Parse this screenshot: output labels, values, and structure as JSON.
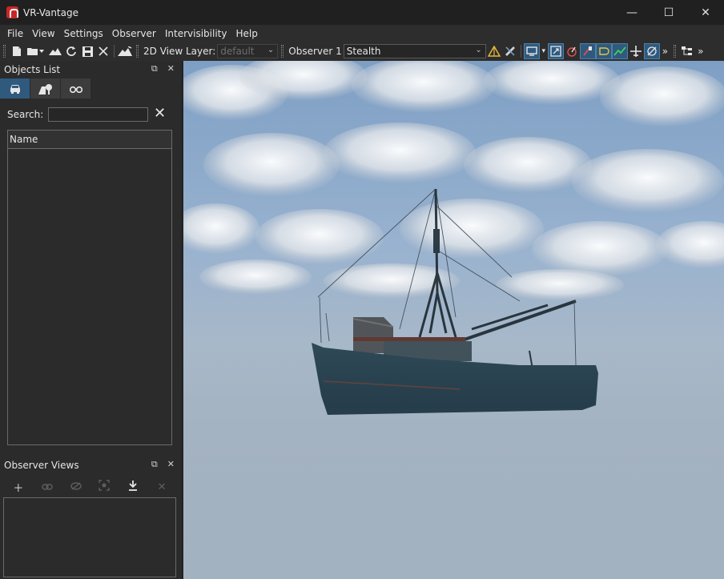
{
  "app": {
    "title": "VR-Vantage"
  },
  "window_controls": {
    "minimize": "—",
    "maximize": "☐",
    "close": "✕"
  },
  "menu": [
    "File",
    "View",
    "Settings",
    "Observer",
    "Intervisibility",
    "Help"
  ],
  "toolbar": {
    "view_layer_label": "2D View Layer:",
    "view_layer_value": "default",
    "observer_label": "Observer 1",
    "observer_mode": "Stealth",
    "overflow": "»"
  },
  "objects_panel": {
    "title": "Objects List",
    "search_label": "Search:",
    "search_value": "",
    "column_header": "Name",
    "clear_glyph": "✕"
  },
  "observer_views_panel": {
    "title": "Observer Views"
  },
  "colors": {
    "accent": "#2f5a7e",
    "background": "#2b2b2b",
    "titlebar": "#202020",
    "app_icon": "#c62828"
  },
  "icons": {
    "new_file": "document-icon",
    "open_folder": "folder-icon",
    "terrain": "terrain-icon",
    "reload": "reload-icon",
    "save": "save-icon",
    "close_scenario": "close-icon",
    "tab_vehicles": "car-icon",
    "tab_environment": "terrain-tree-icon",
    "tab_observers": "binoculars-icon"
  }
}
